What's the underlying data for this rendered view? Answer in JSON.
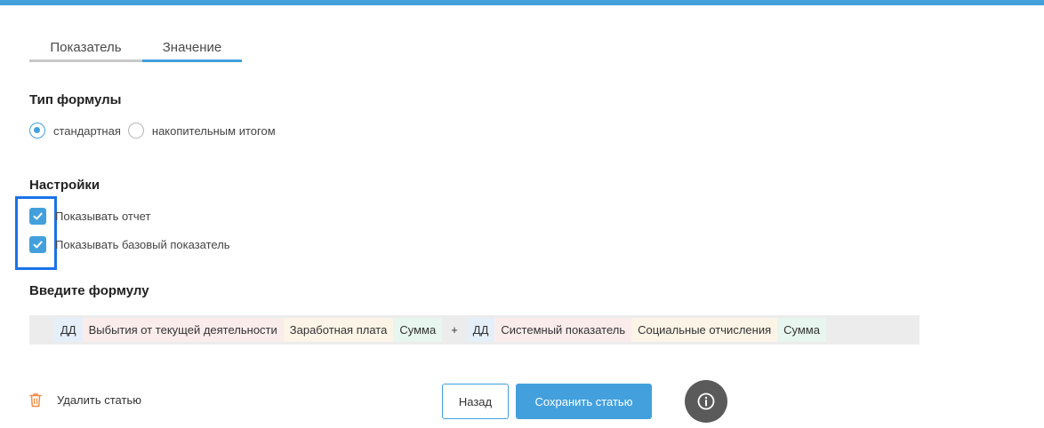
{
  "tabs": [
    {
      "label": "Показатель",
      "active": false
    },
    {
      "label": "Значение",
      "active": true
    }
  ],
  "formula_type": {
    "title": "Тип формулы",
    "options": [
      {
        "label": "стандартная",
        "checked": true
      },
      {
        "label": "накопительным итогом",
        "checked": false
      }
    ]
  },
  "settings": {
    "title": "Настройки",
    "checkboxes": [
      {
        "label": "Показывать отчет",
        "checked": true
      },
      {
        "label": "Показывать базовый показатель",
        "checked": true
      }
    ]
  },
  "formula": {
    "title": "Введите формулу",
    "tokens": [
      {
        "text": "ДД",
        "kind": "blue"
      },
      {
        "text": "Выбытия от текущей деятельности",
        "kind": "pink"
      },
      {
        "text": "Заработная плата",
        "kind": "yellow"
      },
      {
        "text": "Сумма",
        "kind": "green"
      },
      {
        "text": "+",
        "kind": "operator"
      },
      {
        "text": "ДД",
        "kind": "blue"
      },
      {
        "text": "Системный показатель",
        "kind": "pink"
      },
      {
        "text": "Социальные отчисления",
        "kind": "yellow"
      },
      {
        "text": "Сумма",
        "kind": "green"
      }
    ]
  },
  "footer": {
    "delete_label": "Удалить статью",
    "back_label": "Назад",
    "save_label": "Сохранить статью"
  },
  "icons": {
    "trash": "trash-icon",
    "info": "info-icon",
    "check": "checkmark-icon"
  },
  "colors": {
    "accent": "#43a0dc",
    "highlight": "#1a73e8",
    "trash": "#f0883e",
    "info_bg": "#5a5a5a"
  }
}
